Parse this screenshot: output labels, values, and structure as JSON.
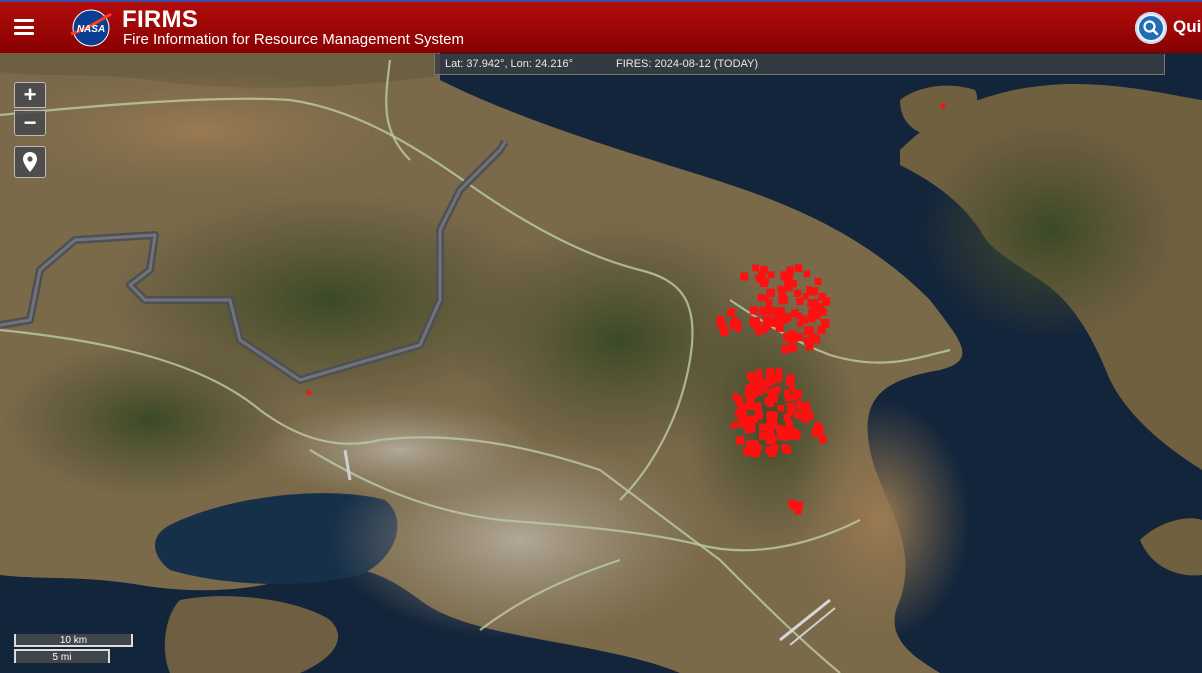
{
  "header": {
    "agency": "NASA",
    "title": "FIRMS",
    "subtitle": "Fire Information for Resource Management System",
    "quick_label": "Quic",
    "bg_color": "#a00a0a"
  },
  "status_bar": {
    "coordinates": "Lat: 37.942°, Lon: 24.216°",
    "fires": "FIRES: 2024-08-12 (TODAY)"
  },
  "controls": {
    "zoom_in": "+",
    "zoom_out": "−",
    "icons": [
      "menu-icon",
      "nasa-logo",
      "search-icon",
      "location-pin-icon"
    ]
  },
  "scale": {
    "km": "10 km",
    "mi": "5 mi"
  },
  "map": {
    "basemap": "satellite",
    "fire_color": "#ff1010",
    "road_color": "#b8c7a0",
    "water_color": "#13253b",
    "land_color": "#7c6b4a"
  }
}
